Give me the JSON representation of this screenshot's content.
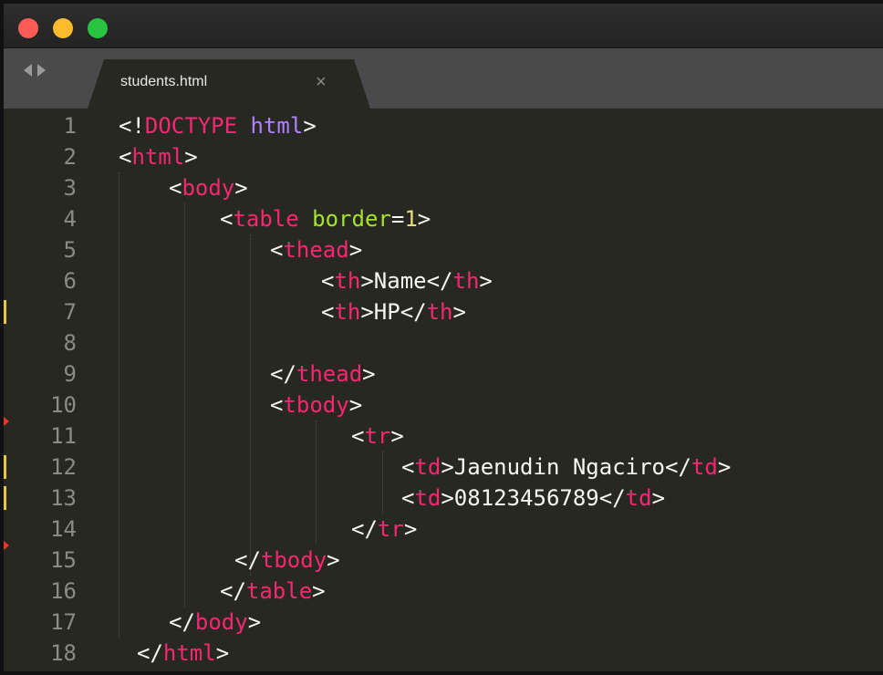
{
  "window": {
    "controls": [
      "close",
      "minimize",
      "zoom"
    ]
  },
  "tab": {
    "title": "students.html",
    "close_label": "×",
    "nav_icons": [
      "arrow-left-icon",
      "arrow-right-icon"
    ]
  },
  "editor": {
    "line_numbers": [
      "1",
      "2",
      "3",
      "4",
      "5",
      "6",
      "7",
      "8",
      "9",
      "10",
      "11",
      "12",
      "13",
      "14",
      "15",
      "16",
      "17",
      "18"
    ],
    "lines": [
      [
        [
          "pn",
          "<!"
        ],
        [
          "tag",
          "DOCTYPE"
        ],
        [
          "pn",
          " "
        ],
        [
          "kw",
          "html"
        ],
        [
          "pn",
          ">"
        ]
      ],
      [
        [
          "pn",
          "<"
        ],
        [
          "tag",
          "html"
        ],
        [
          "pn",
          ">"
        ]
      ],
      [
        [
          "pn",
          "<"
        ],
        [
          "tag",
          "body"
        ],
        [
          "pn",
          ">"
        ]
      ],
      [
        [
          "pn",
          "<"
        ],
        [
          "tag",
          "table"
        ],
        [
          "pn",
          " "
        ],
        [
          "attr",
          "border"
        ],
        [
          "pn",
          "="
        ],
        [
          "num",
          "1"
        ],
        [
          "pn",
          ">"
        ]
      ],
      [
        [
          "pn",
          "<"
        ],
        [
          "tag",
          "thead"
        ],
        [
          "pn",
          ">"
        ]
      ],
      [
        [
          "pn",
          "<"
        ],
        [
          "tag",
          "th"
        ],
        [
          "pn",
          ">Name</"
        ],
        [
          "tag",
          "th"
        ],
        [
          "pn",
          ">"
        ]
      ],
      [
        [
          "pn",
          "<"
        ],
        [
          "tag",
          "th"
        ],
        [
          "pn",
          ">HP</"
        ],
        [
          "tag",
          "th"
        ],
        [
          "pn",
          ">"
        ]
      ],
      [],
      [
        [
          "pn",
          "</"
        ],
        [
          "tag",
          "thead"
        ],
        [
          "pn",
          ">"
        ]
      ],
      [
        [
          "pn",
          "<"
        ],
        [
          "tag",
          "tbody"
        ],
        [
          "pn",
          ">"
        ]
      ],
      [
        [
          "pn",
          "<"
        ],
        [
          "tag",
          "tr"
        ],
        [
          "pn",
          ">"
        ]
      ],
      [
        [
          "pn",
          "<"
        ],
        [
          "tag",
          "td"
        ],
        [
          "pn",
          ">Jaenudin Ngaciro</"
        ],
        [
          "tag",
          "td"
        ],
        [
          "pn",
          ">"
        ]
      ],
      [
        [
          "pn",
          "<"
        ],
        [
          "tag",
          "td"
        ],
        [
          "pn",
          ">08123456789</"
        ],
        [
          "tag",
          "td"
        ],
        [
          "pn",
          ">"
        ]
      ],
      [
        [
          "pn",
          "</"
        ],
        [
          "tag",
          "tr"
        ],
        [
          "pn",
          ">"
        ]
      ],
      [
        [
          "pn",
          "</"
        ],
        [
          "tag",
          "tbody"
        ],
        [
          "pn",
          ">"
        ]
      ],
      [
        [
          "pn",
          "</"
        ],
        [
          "tag",
          "table"
        ],
        [
          "pn",
          ">"
        ]
      ],
      [
        [
          "pn",
          "</"
        ],
        [
          "tag",
          "body"
        ],
        [
          "pn",
          ">"
        ]
      ],
      [
        [
          "pn",
          "</"
        ],
        [
          "tag",
          "html"
        ],
        [
          "pn",
          ">"
        ]
      ]
    ],
    "modified_lines": [
      7,
      12,
      13
    ],
    "error_markers": [
      11,
      15
    ]
  },
  "colors": {
    "background": "#272822",
    "tag": "#f92672",
    "attribute": "#a6e22e",
    "number": "#e6db74",
    "keyword": "#ae81ff",
    "text": "#f8f8f2"
  }
}
